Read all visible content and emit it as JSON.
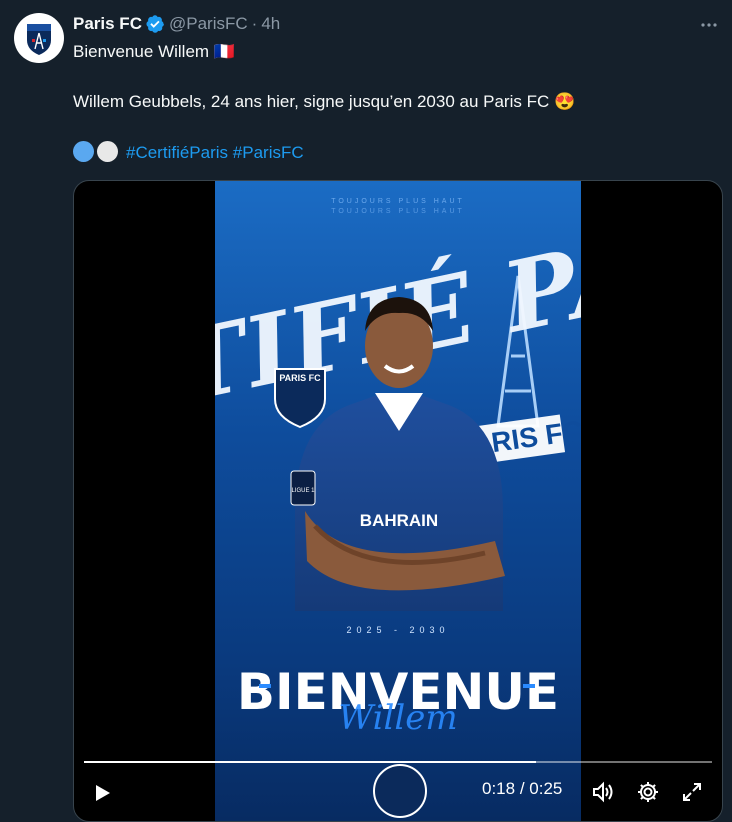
{
  "tweet": {
    "display_name": "Paris FC",
    "handle": "@ParisFC",
    "separator": "·",
    "time": "4h",
    "line1_text": "Bienvenue Willem",
    "line1_emoji": "🇫🇷",
    "line2_text": "Willem Geubbels, 24 ans hier, signe jusqu’en 2030 au Paris FC",
    "line2_emoji": "😍",
    "hashtags": [
      "#CertifiéParis",
      "#ParisFC"
    ]
  },
  "avatar": {
    "logo_text": "PARIS FC"
  },
  "poster": {
    "headline": "CERTIFIÉ PARIS",
    "badge_text": "PARIS FC",
    "club_wordmark": "PARIS FC",
    "sponsor_chest": "BAHRAIN",
    "sleeve_badge": "LIGUE 1",
    "years": "2025 - 2030",
    "welcome": "BIENVENUE",
    "player_script": "Willem"
  },
  "video": {
    "current_time": "0:18",
    "time_separator": "/",
    "duration": "0:25",
    "progress_fraction": 0.72
  },
  "colors": {
    "background": "#15202b",
    "accent": "#1d9bf0",
    "secondary_text": "#8b98a5"
  }
}
